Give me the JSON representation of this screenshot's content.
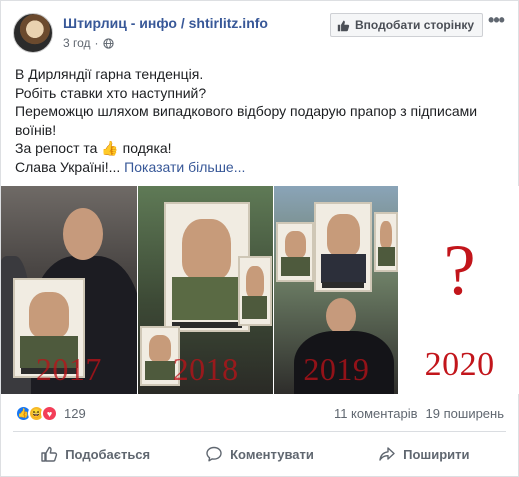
{
  "header": {
    "page_name": "Штирлиц - инфо / shtirlitz.info",
    "time": "3 год",
    "like_page_label": "Вподобати сторінку",
    "more_label": "•••"
  },
  "post": {
    "lines": [
      "В Дирляндії гарна тенденція.",
      "Робіть ставки хто наступний?",
      "Переможцю шляхом випадкового відбору подарую прапор з підписами",
      "воїнів!",
      "За репост та",
      "подяка!",
      "Слава Україні!...",
      "Показати більше..."
    ]
  },
  "image": {
    "panels": [
      {
        "year": "2017"
      },
      {
        "year": "2018"
      },
      {
        "year": "2019"
      },
      {
        "year": "2020",
        "symbol": "?"
      }
    ]
  },
  "reactions": {
    "icons": [
      "like-icon",
      "haha-icon",
      "love-icon"
    ],
    "count": "129",
    "comments": "11 коментарів",
    "shares": "19 поширень"
  },
  "actions": {
    "like": "Подобається",
    "comment": "Коментувати",
    "share": "Поширити"
  },
  "colors": {
    "link": "#385898",
    "accent_red": "#c2151b",
    "like_blue": "#1877f2"
  }
}
